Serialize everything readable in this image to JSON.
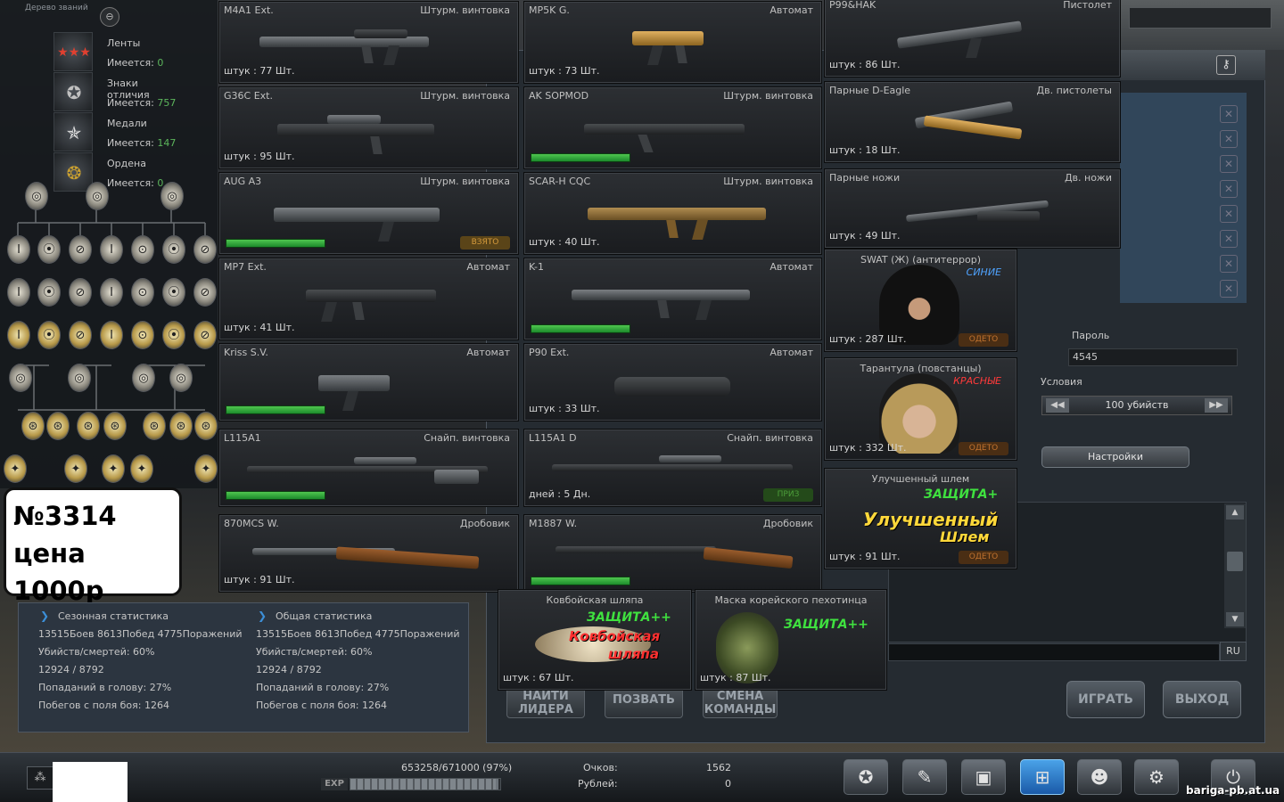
{
  "medals": [
    {
      "name": "Ленты",
      "count_label": "Имеется:",
      "count": "0",
      "icon": "ribbon-icon"
    },
    {
      "name": "Знаки отличия",
      "count_label": "Имеется:",
      "count": "757",
      "icon": "insignia-icon"
    },
    {
      "name": "Медали",
      "count_label": "Имеется:",
      "count": "147",
      "icon": "medal-icon"
    },
    {
      "name": "Ордена",
      "count_label": "Имеется:",
      "count": "0",
      "icon": "order-icon"
    }
  ],
  "tree_title": "Дерево званий",
  "price": {
    "number": "№3314",
    "price": "цена 1000р"
  },
  "items": [
    {
      "name": "M4A1 Ext.",
      "type": "Штурм. винтовка",
      "qty": "штук : 77 Шт."
    },
    {
      "name": "G36C Ext.",
      "type": "Штурм. винтовка",
      "qty": "штук : 95 Шт."
    },
    {
      "name": "AUG A3",
      "type": "Штурм. винтовка",
      "tag": "ВЗЯТО"
    },
    {
      "name": "MP7 Ext.",
      "type": "Автомат",
      "qty": "штук : 41 Шт."
    },
    {
      "name": "Kriss S.V.",
      "type": "Автомат"
    },
    {
      "name": "L115A1",
      "type": "Снайп. винтовка"
    },
    {
      "name": "870MCS W.",
      "type": "Дробовик",
      "qty": "штук : 91 Шт."
    },
    {
      "name": "MP5K G.",
      "type": "Автомат",
      "qty": "штук : 73 Шт."
    },
    {
      "name": "AK SOPMOD",
      "type": "Штурм. винтовка"
    },
    {
      "name": "SCAR-H CQC",
      "type": "Штурм. винтовка",
      "qty": "штук : 40 Шт."
    },
    {
      "name": "K-1",
      "type": "Автомат"
    },
    {
      "name": "P90 Ext.",
      "type": "Автомат",
      "qty": "штук : 33 Шт."
    },
    {
      "name": "L115A1 D",
      "type": "Снайп. винтовка",
      "qty": "дней : 5 Дн.",
      "tag": "ПРИЗ"
    },
    {
      "name": "M1887 W.",
      "type": "Дробовик"
    },
    {
      "name": "P99&HAK",
      "type": "Пистолет",
      "qty": "штук : 86 Шт."
    },
    {
      "name": "Парные D-Eagle",
      "type": "Дв. пистолеты",
      "qty": "штук : 18 Шт."
    },
    {
      "name": "Парные ножи",
      "type": "Дв. ножи",
      "qty": "штук : 49 Шт."
    },
    {
      "name": "SWAT (Ж) (антитеррор)",
      "team": "СИНИЕ",
      "qty": "штук : 287 Шт.",
      "tag": "ОДЕТО"
    },
    {
      "name": "Тарантула (повстанцы)",
      "team": "КРАСНЫЕ",
      "qty": "штук : 332 Шт.",
      "tag": "ОДЕТО"
    },
    {
      "name": "Улучшенный шлем",
      "protection": "ЗАЩИТА+",
      "art1": "Улучшенный",
      "art2": "Шлем",
      "qty": "штук : 91 Шт.",
      "tag": "ОДЕТО"
    },
    {
      "name": "Ковбойская шляпа",
      "protection": "ЗАЩИТА++",
      "art1": "Ковбойская",
      "art2": "шляпа",
      "qty": "штук : 67 Шт."
    },
    {
      "name": "Маска корейского пехотинца",
      "protection": "ЗАЩИТА++",
      "qty": "штук : 87 Шт."
    }
  ],
  "stats": {
    "season": {
      "title": "Сезонная статистика",
      "battles": "13515Боев 8613Побед 4775Поражений",
      "kd": "Убийств/смертей: 60%",
      "kd_raw": "12924 / 8792",
      "headshots": "Попаданий в голову: 27%",
      "escapes": "Побегов с поля боя: 1264"
    },
    "total": {
      "title": "Общая статистика",
      "battles": "13515Боев 8613Побед 4775Поражений",
      "kd": "Убийств/смертей: 60%",
      "kd_raw": "12924 / 8792",
      "headshots": "Попаданий в голову: 27%",
      "escapes": "Побегов с поля боя: 1264"
    }
  },
  "room": {
    "password_label": "Пароль",
    "password_value": "4545",
    "conditions_label": "Условия",
    "condition_value": "100 убийств",
    "settings_label": "Настройки",
    "lang": "RU"
  },
  "buttons": {
    "find_leader": "НАЙТИ ЛИДЕРА",
    "invite": "ПОЗВАТЬ",
    "change_team": "СМЕНА КОМАНДЫ",
    "play": "ИГРАТЬ",
    "exit": "ВЫХОД"
  },
  "footer": {
    "exp_text": "653258/671000 (97%)",
    "exp_label": "EXP",
    "exp_progress": 0.97,
    "points_label": "Очков:",
    "points": "1562",
    "rubles_label": "Рублей:",
    "rubles": "0",
    "site": "bariga-pb.at.ua"
  },
  "nav": [
    "profile-icon",
    "notes-icon",
    "inventory-icon",
    "shop-icon",
    "clan-icon",
    "settings-icon",
    "power-icon"
  ]
}
